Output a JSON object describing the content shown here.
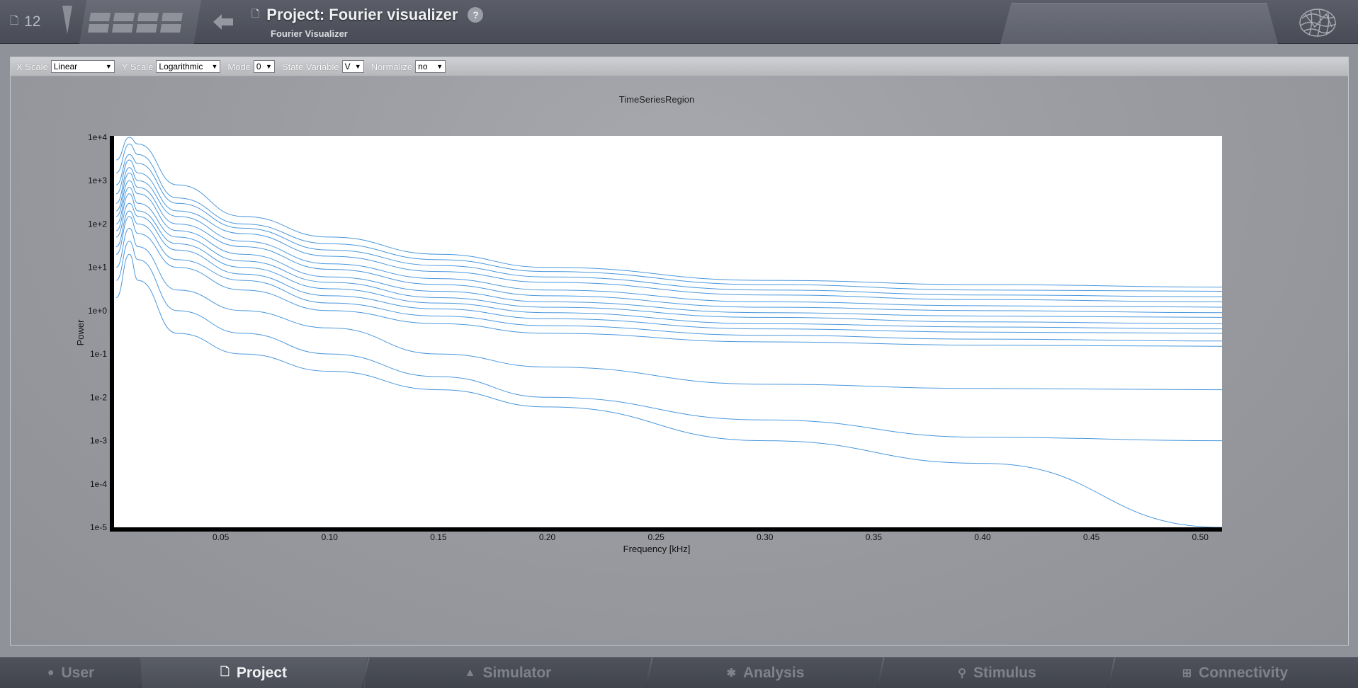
{
  "header": {
    "project_count": "12",
    "project_count_icon": "document-icon",
    "title": "Project: Fourier visualizer",
    "subtitle": "Fourier Visualizer",
    "help_label": "?"
  },
  "toolbar": {
    "x_scale": {
      "label": "X Scale",
      "value": "Linear"
    },
    "y_scale": {
      "label": "Y Scale",
      "value": "Logarithmic"
    },
    "mode": {
      "label": "Mode",
      "value": "0"
    },
    "state_variable": {
      "label": "State Variable",
      "value": "V"
    },
    "normalize": {
      "label": "Normalize",
      "value": "no"
    }
  },
  "nav": {
    "tabs": [
      {
        "label": "User",
        "icon": "user-icon",
        "active": false
      },
      {
        "label": "Project",
        "icon": "document-icon",
        "active": true
      },
      {
        "label": "Simulator",
        "icon": "rocket-icon",
        "active": false
      },
      {
        "label": "Analysis",
        "icon": "gear-icon",
        "active": false
      },
      {
        "label": "Stimulus",
        "icon": "pin-icon",
        "active": false
      },
      {
        "label": "Connectivity",
        "icon": "network-icon",
        "active": false
      }
    ]
  },
  "colors": {
    "line": "#4a97dc",
    "plot_bg": "#ffffff",
    "axis": "#000000"
  },
  "chart_data": {
    "type": "line",
    "title": "TimeSeriesRegion",
    "xlabel": "Frequency [kHz]",
    "ylabel": "Power",
    "x_scale": "linear",
    "y_scale": "log",
    "xlim": [
      0.0,
      0.51
    ],
    "ylim": [
      1e-05,
      10000.0
    ],
    "x_ticks": [
      "0.05",
      "0.10",
      "0.15",
      "0.20",
      "0.25",
      "0.30",
      "0.35",
      "0.40",
      "0.45",
      "0.50"
    ],
    "x_tick_values": [
      0.05,
      0.1,
      0.15,
      0.2,
      0.25,
      0.3,
      0.35,
      0.4,
      0.45,
      0.5
    ],
    "y_ticks": [
      "1e+4",
      "1e+3",
      "1e+2",
      "1e+1",
      "1e+0",
      "1e-1",
      "1e-2",
      "1e-3",
      "1e-4",
      "1e-5"
    ],
    "y_tick_values": [
      10000.0,
      1000.0,
      100.0,
      10.0,
      1.0,
      0.1,
      0.01,
      0.001,
      0.0001,
      1e-05
    ],
    "legend": "none",
    "grid": false,
    "series_note_count": 76,
    "series": [
      {
        "x": [
          0.002,
          0.008,
          0.012,
          0.03,
          0.06,
          0.1,
          0.15,
          0.2,
          0.3,
          0.4,
          0.51
        ],
        "y": [
          3000,
          10000,
          7000,
          800,
          150,
          50,
          20,
          10,
          5,
          4,
          3.5
        ]
      },
      {
        "x": [
          0.002,
          0.008,
          0.012,
          0.03,
          0.06,
          0.1,
          0.15,
          0.2,
          0.3,
          0.4,
          0.51
        ],
        "y": [
          1500,
          7000,
          4000,
          400,
          100,
          35,
          15,
          8,
          4,
          3,
          2.8
        ]
      },
      {
        "x": [
          0.002,
          0.008,
          0.012,
          0.03,
          0.06,
          0.1,
          0.15,
          0.2,
          0.3,
          0.4,
          0.51
        ],
        "y": [
          800,
          4000,
          2500,
          300,
          80,
          25,
          11,
          6,
          3,
          2.3,
          2.1
        ]
      },
      {
        "x": [
          0.002,
          0.008,
          0.012,
          0.03,
          0.06,
          0.1,
          0.15,
          0.2,
          0.3,
          0.4,
          0.51
        ],
        "y": [
          500,
          3000,
          1500,
          200,
          60,
          18,
          8,
          4.5,
          2.3,
          1.8,
          1.6
        ]
      },
      {
        "x": [
          0.002,
          0.008,
          0.012,
          0.03,
          0.06,
          0.1,
          0.15,
          0.2,
          0.3,
          0.4,
          0.51
        ],
        "y": [
          300,
          2000,
          1000,
          150,
          40,
          12,
          5.5,
          3,
          1.6,
          1.3,
          1.2
        ]
      },
      {
        "x": [
          0.002,
          0.008,
          0.012,
          0.03,
          0.06,
          0.1,
          0.15,
          0.2,
          0.3,
          0.4,
          0.51
        ],
        "y": [
          200,
          1500,
          700,
          100,
          30,
          9,
          4,
          2.2,
          1.2,
          1.0,
          0.9
        ]
      },
      {
        "x": [
          0.002,
          0.008,
          0.012,
          0.03,
          0.06,
          0.1,
          0.15,
          0.2,
          0.3,
          0.4,
          0.51
        ],
        "y": [
          150,
          1000,
          500,
          70,
          20,
          6,
          2.8,
          1.6,
          0.9,
          0.75,
          0.7
        ]
      },
      {
        "x": [
          0.002,
          0.008,
          0.012,
          0.03,
          0.06,
          0.1,
          0.15,
          0.2,
          0.3,
          0.4,
          0.51
        ],
        "y": [
          100,
          700,
          300,
          50,
          14,
          4.5,
          2.0,
          1.2,
          0.7,
          0.55,
          0.5
        ]
      },
      {
        "x": [
          0.002,
          0.008,
          0.012,
          0.03,
          0.06,
          0.1,
          0.15,
          0.2,
          0.3,
          0.4,
          0.51
        ],
        "y": [
          70,
          500,
          200,
          35,
          10,
          3.2,
          1.5,
          0.9,
          0.5,
          0.42,
          0.38
        ]
      },
      {
        "x": [
          0.002,
          0.008,
          0.012,
          0.03,
          0.06,
          0.1,
          0.15,
          0.2,
          0.3,
          0.4,
          0.51
        ],
        "y": [
          50,
          300,
          150,
          25,
          7,
          2.2,
          1.1,
          0.65,
          0.38,
          0.32,
          0.3
        ]
      },
      {
        "x": [
          0.002,
          0.008,
          0.012,
          0.03,
          0.06,
          0.1,
          0.15,
          0.2,
          0.3,
          0.4,
          0.51
        ],
        "y": [
          30,
          200,
          100,
          15,
          5,
          1.5,
          0.75,
          0.45,
          0.27,
          0.22,
          0.2
        ]
      },
      {
        "x": [
          0.002,
          0.008,
          0.012,
          0.03,
          0.06,
          0.1,
          0.15,
          0.2,
          0.3,
          0.4,
          0.51
        ],
        "y": [
          20,
          150,
          60,
          10,
          3,
          1.0,
          0.5,
          0.3,
          0.19,
          0.16,
          0.15
        ]
      },
      {
        "x": [
          0.002,
          0.008,
          0.012,
          0.03,
          0.06,
          0.1,
          0.15,
          0.2,
          0.3,
          0.4,
          0.51
        ],
        "y": [
          10,
          80,
          30,
          3,
          1,
          0.4,
          0.1,
          0.05,
          0.02,
          0.016,
          0.015
        ]
      },
      {
        "x": [
          0.002,
          0.008,
          0.012,
          0.03,
          0.06,
          0.1,
          0.15,
          0.2,
          0.3,
          0.4,
          0.51
        ],
        "y": [
          5,
          40,
          15,
          1,
          0.3,
          0.1,
          0.03,
          0.01,
          0.003,
          0.0012,
          0.001
        ]
      },
      {
        "x": [
          0.002,
          0.008,
          0.012,
          0.03,
          0.06,
          0.1,
          0.15,
          0.2,
          0.3,
          0.4,
          0.51
        ],
        "y": [
          2,
          20,
          5,
          0.3,
          0.1,
          0.04,
          0.015,
          0.006,
          0.001,
          0.0003,
          1e-05
        ]
      }
    ]
  }
}
